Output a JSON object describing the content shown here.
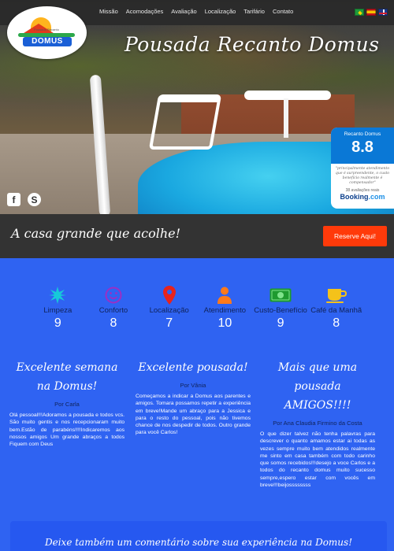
{
  "nav": {
    "items": [
      "Missão",
      "Acomodações",
      "Avaliação",
      "Localização",
      "Tarifário",
      "Contato"
    ]
  },
  "logo": {
    "text": "DOMUS",
    "subtext": "Pousada Recanto"
  },
  "hero": {
    "title": "Pousada Recanto Domus"
  },
  "booking": {
    "name": "Recanto Domus",
    "score": "8.8",
    "quote": "\"principalmente atendimento que é surpreendente, o custo benefício realmente é compensador\"",
    "count": "38 avaliações reais",
    "brand_main": "Booking",
    "brand_dot": ".com"
  },
  "tagline": {
    "text": "A casa grande que acolhe!",
    "button": "Reserve Aqui!"
  },
  "ratings": [
    {
      "label": "Limpeza",
      "value": "9",
      "icon": "sparkle-icon",
      "color": "#16c9d9"
    },
    {
      "label": "Conforto",
      "value": "8",
      "icon": "smiley-icon",
      "color": "#9b2fc4"
    },
    {
      "label": "Localização",
      "value": "7",
      "icon": "map-pin-icon",
      "color": "#e8231d"
    },
    {
      "label": "Atendimento",
      "value": "10",
      "icon": "person-icon",
      "color": "#ff7a1a"
    },
    {
      "label": "Custo-Benefício",
      "value": "9",
      "icon": "money-icon",
      "color": "#1e9a2f"
    },
    {
      "label": "Café da Manhã",
      "value": "8",
      "icon": "coffee-cup-icon",
      "color": "#f4c21a"
    }
  ],
  "testimonials": [
    {
      "title": "Excelente semana na Domus!",
      "author": "Por Carla",
      "text": "Olá pessoal!!!Adoramos a pousada e todos vcs. São muito gentis e nos recepcionaram muito bem.Estão de parabéns!!!!Indicaremos aos nossos amigos Um grande abraços a todos Fiquem com Deus"
    },
    {
      "title": "Excelente pousada!",
      "author": "Por Vânia",
      "text": "Começamos a indicar a Domus aos parentes e amigos. Tomara possamos repetir a experiência em breve!Mande um abraço para a Jessica e para o resto do pessoal, pois não tivemos chance de nos despedir de todos. Outro grande para você Carlos!"
    },
    {
      "title": "Mais que uma pousada AMIGOS!!!!",
      "author": "Por Ana Claudia Firmino da Costa",
      "text": "O que dizer talvez não tenha palavras para descrever o quanto amamos estar ai todas as vezes sempre muito bem atendidos realmente me sinto em casa também com todo carinho que somos recebidos!!!desejo a voce Carlos e a todos do recanto domus muito sucesso sempre,espero estar com vocês em breve!!!beijossssssss"
    }
  ],
  "comment": {
    "text": "Deixe também um comentário sobre sua experiência na Domus!"
  }
}
